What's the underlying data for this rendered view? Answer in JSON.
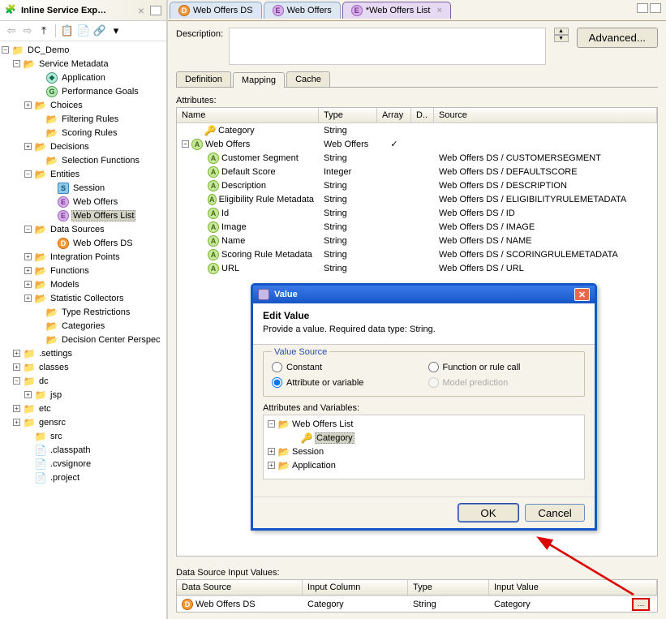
{
  "sidebar": {
    "title": "Inline Service Exp…",
    "tree": {
      "root": "DC_Demo",
      "service_metadata": "Service Metadata",
      "application": "Application",
      "perf_goals": "Performance Goals",
      "choices": "Choices",
      "filtering": "Filtering Rules",
      "scoring": "Scoring Rules",
      "decisions": "Decisions",
      "selection_fn": "Selection Functions",
      "entities": "Entities",
      "session": "Session",
      "web_offers": "Web Offers",
      "web_offers_list": "Web Offers List",
      "data_sources": "Data Sources",
      "web_offers_ds": "Web Offers DS",
      "integration_points": "Integration Points",
      "functions": "Functions",
      "models": "Models",
      "stat_collectors": "Statistic Collectors",
      "type_restrictions": "Type Restrictions",
      "categories": "Categories",
      "dc_persp": "Decision Center Perspec",
      "settings": ".settings",
      "classes": "classes",
      "dc": "dc",
      "jsp": "jsp",
      "etc": "etc",
      "gensrc": "gensrc",
      "src": "src",
      "classpath": ".classpath",
      "cvsignore": ".cvsignore",
      "project": ".project"
    }
  },
  "editor_tabs": {
    "t0": "Web Offers DS",
    "t1": "Web Offers",
    "t2": "*Web Offers List"
  },
  "editor": {
    "desc_label": "Description:",
    "advanced": "Advanced...",
    "tab_def": "Definition",
    "tab_map": "Mapping",
    "tab_cache": "Cache",
    "attributes_label": "Attributes:",
    "th_name": "Name",
    "th_type": "Type",
    "th_array": "Array",
    "th_d": "D..",
    "th_source": "Source",
    "rows": [
      {
        "name": "Category",
        "type": "String",
        "array": "",
        "d": "",
        "source": "",
        "icon": "key",
        "indent": 1
      },
      {
        "name": "Web Offers",
        "type": "Web Offers",
        "array": "✓",
        "d": "",
        "source": "",
        "icon": "A",
        "indent": 0,
        "expandable": true
      },
      {
        "name": "Customer Segment",
        "type": "String",
        "array": "",
        "d": "",
        "source": "Web Offers DS / CUSTOMERSEGMENT",
        "icon": "A",
        "indent": 2
      },
      {
        "name": "Default Score",
        "type": "Integer",
        "array": "",
        "d": "",
        "source": "Web Offers DS / DEFAULTSCORE",
        "icon": "A",
        "indent": 2
      },
      {
        "name": "Description",
        "type": "String",
        "array": "",
        "d": "",
        "source": "Web Offers DS / DESCRIPTION",
        "icon": "A",
        "indent": 2
      },
      {
        "name": "Eligibility Rule Metadata",
        "type": "String",
        "array": "",
        "d": "",
        "source": "Web Offers DS / ELIGIBILITYRULEMETADATA",
        "icon": "A",
        "indent": 2
      },
      {
        "name": "Id",
        "type": "String",
        "array": "",
        "d": "",
        "source": "Web Offers DS / ID",
        "icon": "A",
        "indent": 2
      },
      {
        "name": "Image",
        "type": "String",
        "array": "",
        "d": "",
        "source": "Web Offers DS / IMAGE",
        "icon": "A",
        "indent": 2
      },
      {
        "name": "Name",
        "type": "String",
        "array": "",
        "d": "",
        "source": "Web Offers DS / NAME",
        "icon": "A",
        "indent": 2
      },
      {
        "name": "Scoring Rule Metadata",
        "type": "String",
        "array": "",
        "d": "",
        "source": "Web Offers DS / SCORINGRULEMETADATA",
        "icon": "A",
        "indent": 2
      },
      {
        "name": "URL",
        "type": "String",
        "array": "",
        "d": "",
        "source": "Web Offers DS / URL",
        "icon": "A",
        "indent": 2
      }
    ],
    "ds_label": "Data Source Input Values:",
    "ds_th_ds": "Data Source",
    "ds_th_col": "Input Column",
    "ds_th_type": "Type",
    "ds_th_val": "Input Value",
    "ds_row": {
      "ds": "Web Offers DS",
      "col": "Category",
      "type": "String",
      "val": "Category"
    }
  },
  "dialog": {
    "title": "Value",
    "heading": "Edit Value",
    "instruction": "Provide a value. Required data type: String.",
    "fieldset": "Value Source",
    "opt_constant": "Constant",
    "opt_attr": "Attribute or variable",
    "opt_func": "Function or rule call",
    "opt_model": "Model prediction",
    "av_label": "Attributes and Variables:",
    "tree_wol": "Web Offers List",
    "tree_cat": "Category",
    "tree_session": "Session",
    "tree_app": "Application",
    "ok": "OK",
    "cancel": "Cancel"
  }
}
